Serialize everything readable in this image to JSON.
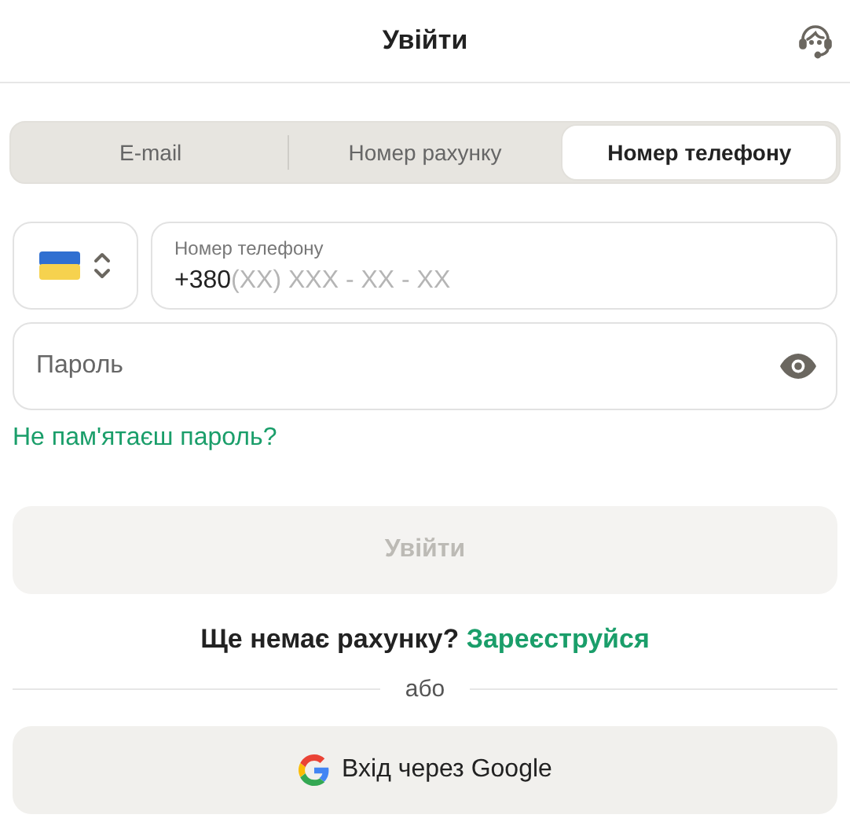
{
  "header": {
    "title": "Увійти"
  },
  "tabs": [
    {
      "label": "E-mail",
      "selected": false
    },
    {
      "label": "Номер рахунку",
      "selected": false
    },
    {
      "label": "Номер телефону",
      "selected": true
    }
  ],
  "phone_field": {
    "label": "Номер телефону",
    "prefix": "+380",
    "placeholder": "(XX) XXX - XX - XX"
  },
  "password_field": {
    "placeholder": "Пароль"
  },
  "forgot_link": "Не пам'ятаєш пароль?",
  "login_button": {
    "label": "Увійти",
    "disabled": true
  },
  "signup": {
    "text": "Ще немає рахунку?",
    "link": "Зареєструйся"
  },
  "divider": "або",
  "google_button": "Вхід через Google"
}
